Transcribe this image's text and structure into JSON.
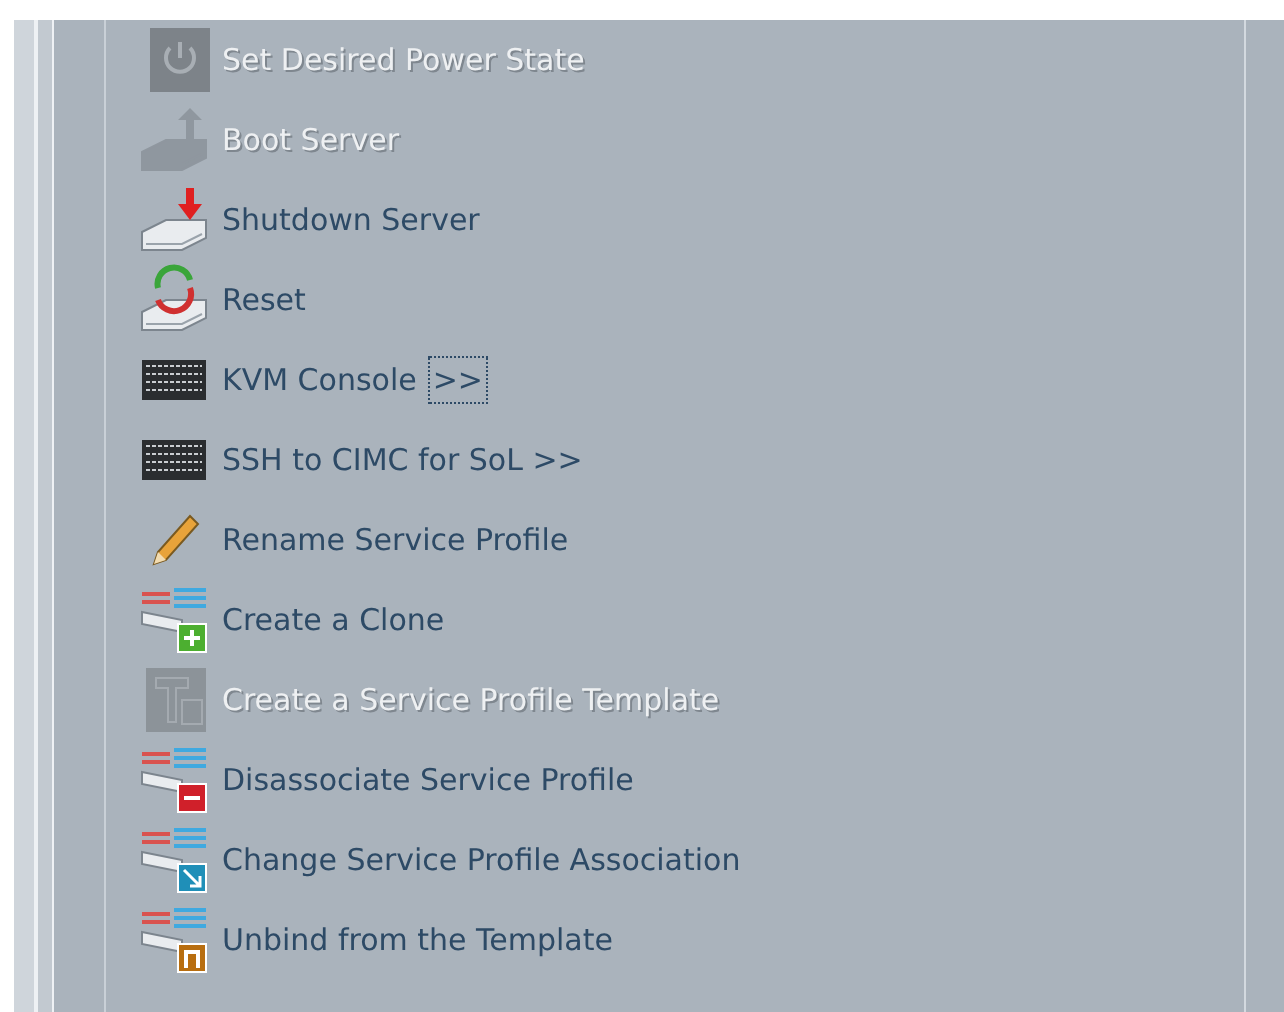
{
  "menu": [
    {
      "kind": "power",
      "label": "Set Desired Power State",
      "disabled": true
    },
    {
      "kind": "boot",
      "label": "Boot Server",
      "disabled": true
    },
    {
      "kind": "shutdown",
      "label": "Shutdown Server",
      "disabled": false
    },
    {
      "kind": "reset",
      "label": "Reset",
      "disabled": false
    },
    {
      "kind": "keyboard",
      "label": "KVM Console",
      "disabled": false,
      "link": {
        "text": ">>",
        "focused": true
      }
    },
    {
      "kind": "keyboard",
      "label": "SSH to CIMC for SoL >>",
      "disabled": false
    },
    {
      "kind": "pencil",
      "label": "Rename Service Profile",
      "disabled": false
    },
    {
      "kind": "profile-add",
      "label": "Create a Clone",
      "disabled": false
    },
    {
      "kind": "template",
      "label": "Create a Service Profile Template",
      "disabled": true
    },
    {
      "kind": "profile-remove",
      "label": "Disassociate Service Profile",
      "disabled": false
    },
    {
      "kind": "profile-change",
      "label": "Change Service Profile Association",
      "disabled": false
    },
    {
      "kind": "profile-unbind",
      "label": "Unbind from the Template",
      "disabled": false
    }
  ]
}
